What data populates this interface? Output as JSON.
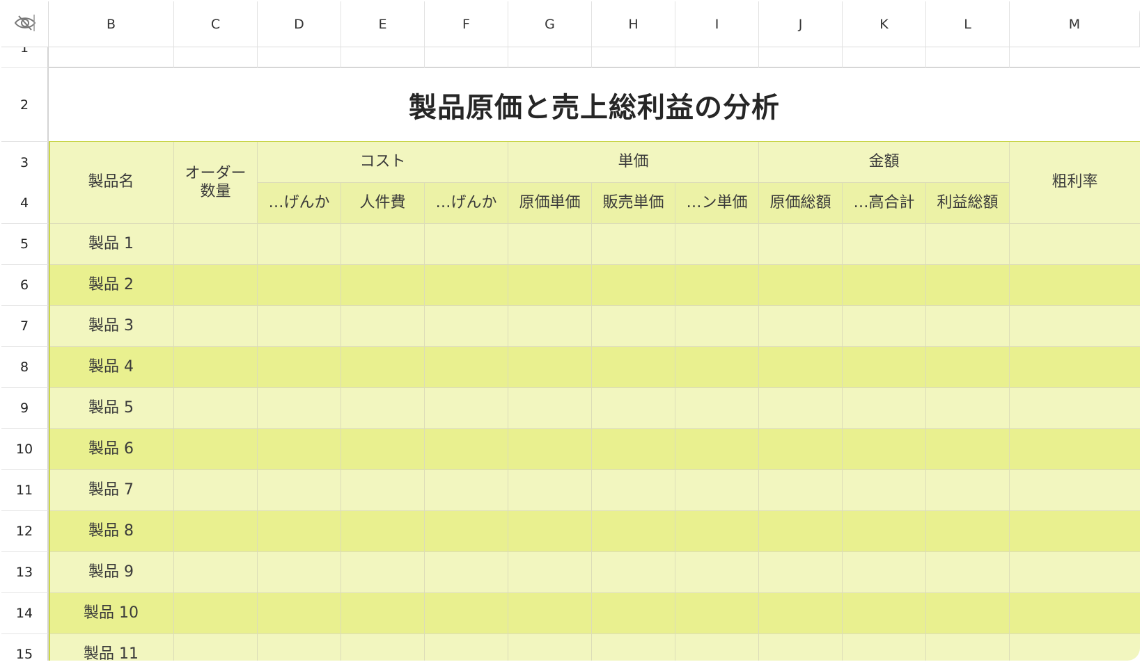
{
  "sheet": {
    "column_headers": [
      "B",
      "C",
      "D",
      "E",
      "F",
      "G",
      "H",
      "I",
      "J",
      "K",
      "L",
      "M"
    ],
    "row_numbers": [
      "1",
      "2",
      "3",
      "4",
      "5",
      "6",
      "7",
      "8",
      "9",
      "10",
      "11",
      "12",
      "13",
      "14",
      "15"
    ],
    "title": "製品原価と売上総利益の分析",
    "headers": {
      "product_name": "製品名",
      "order_qty": "オーダー\n数量",
      "cost_group": "コスト",
      "unit_price_group": "単価",
      "amount_group": "金額",
      "gross_margin": "粗利率",
      "cost_sub": [
        "…げんか",
        "人件費",
        "…げんか"
      ],
      "unit_price_sub": [
        "原価単価",
        "販売単価",
        "…ン単価"
      ],
      "amount_sub": [
        "原価総額",
        "…高合計",
        "利益総額"
      ]
    },
    "products": [
      "製品 1",
      "製品 2",
      "製品 3",
      "製品 4",
      "製品 5",
      "製品 6",
      "製品 7",
      "製品 8",
      "製品 9",
      "製品 10",
      "製品 11"
    ]
  },
  "colors": {
    "header_fill": "#f2f6bf",
    "band_light": "#f2f6bf",
    "band_dark": "#e9f08f",
    "accent_line": "#c8d44a"
  },
  "icons": {
    "corner": "hide-eye-icon"
  }
}
